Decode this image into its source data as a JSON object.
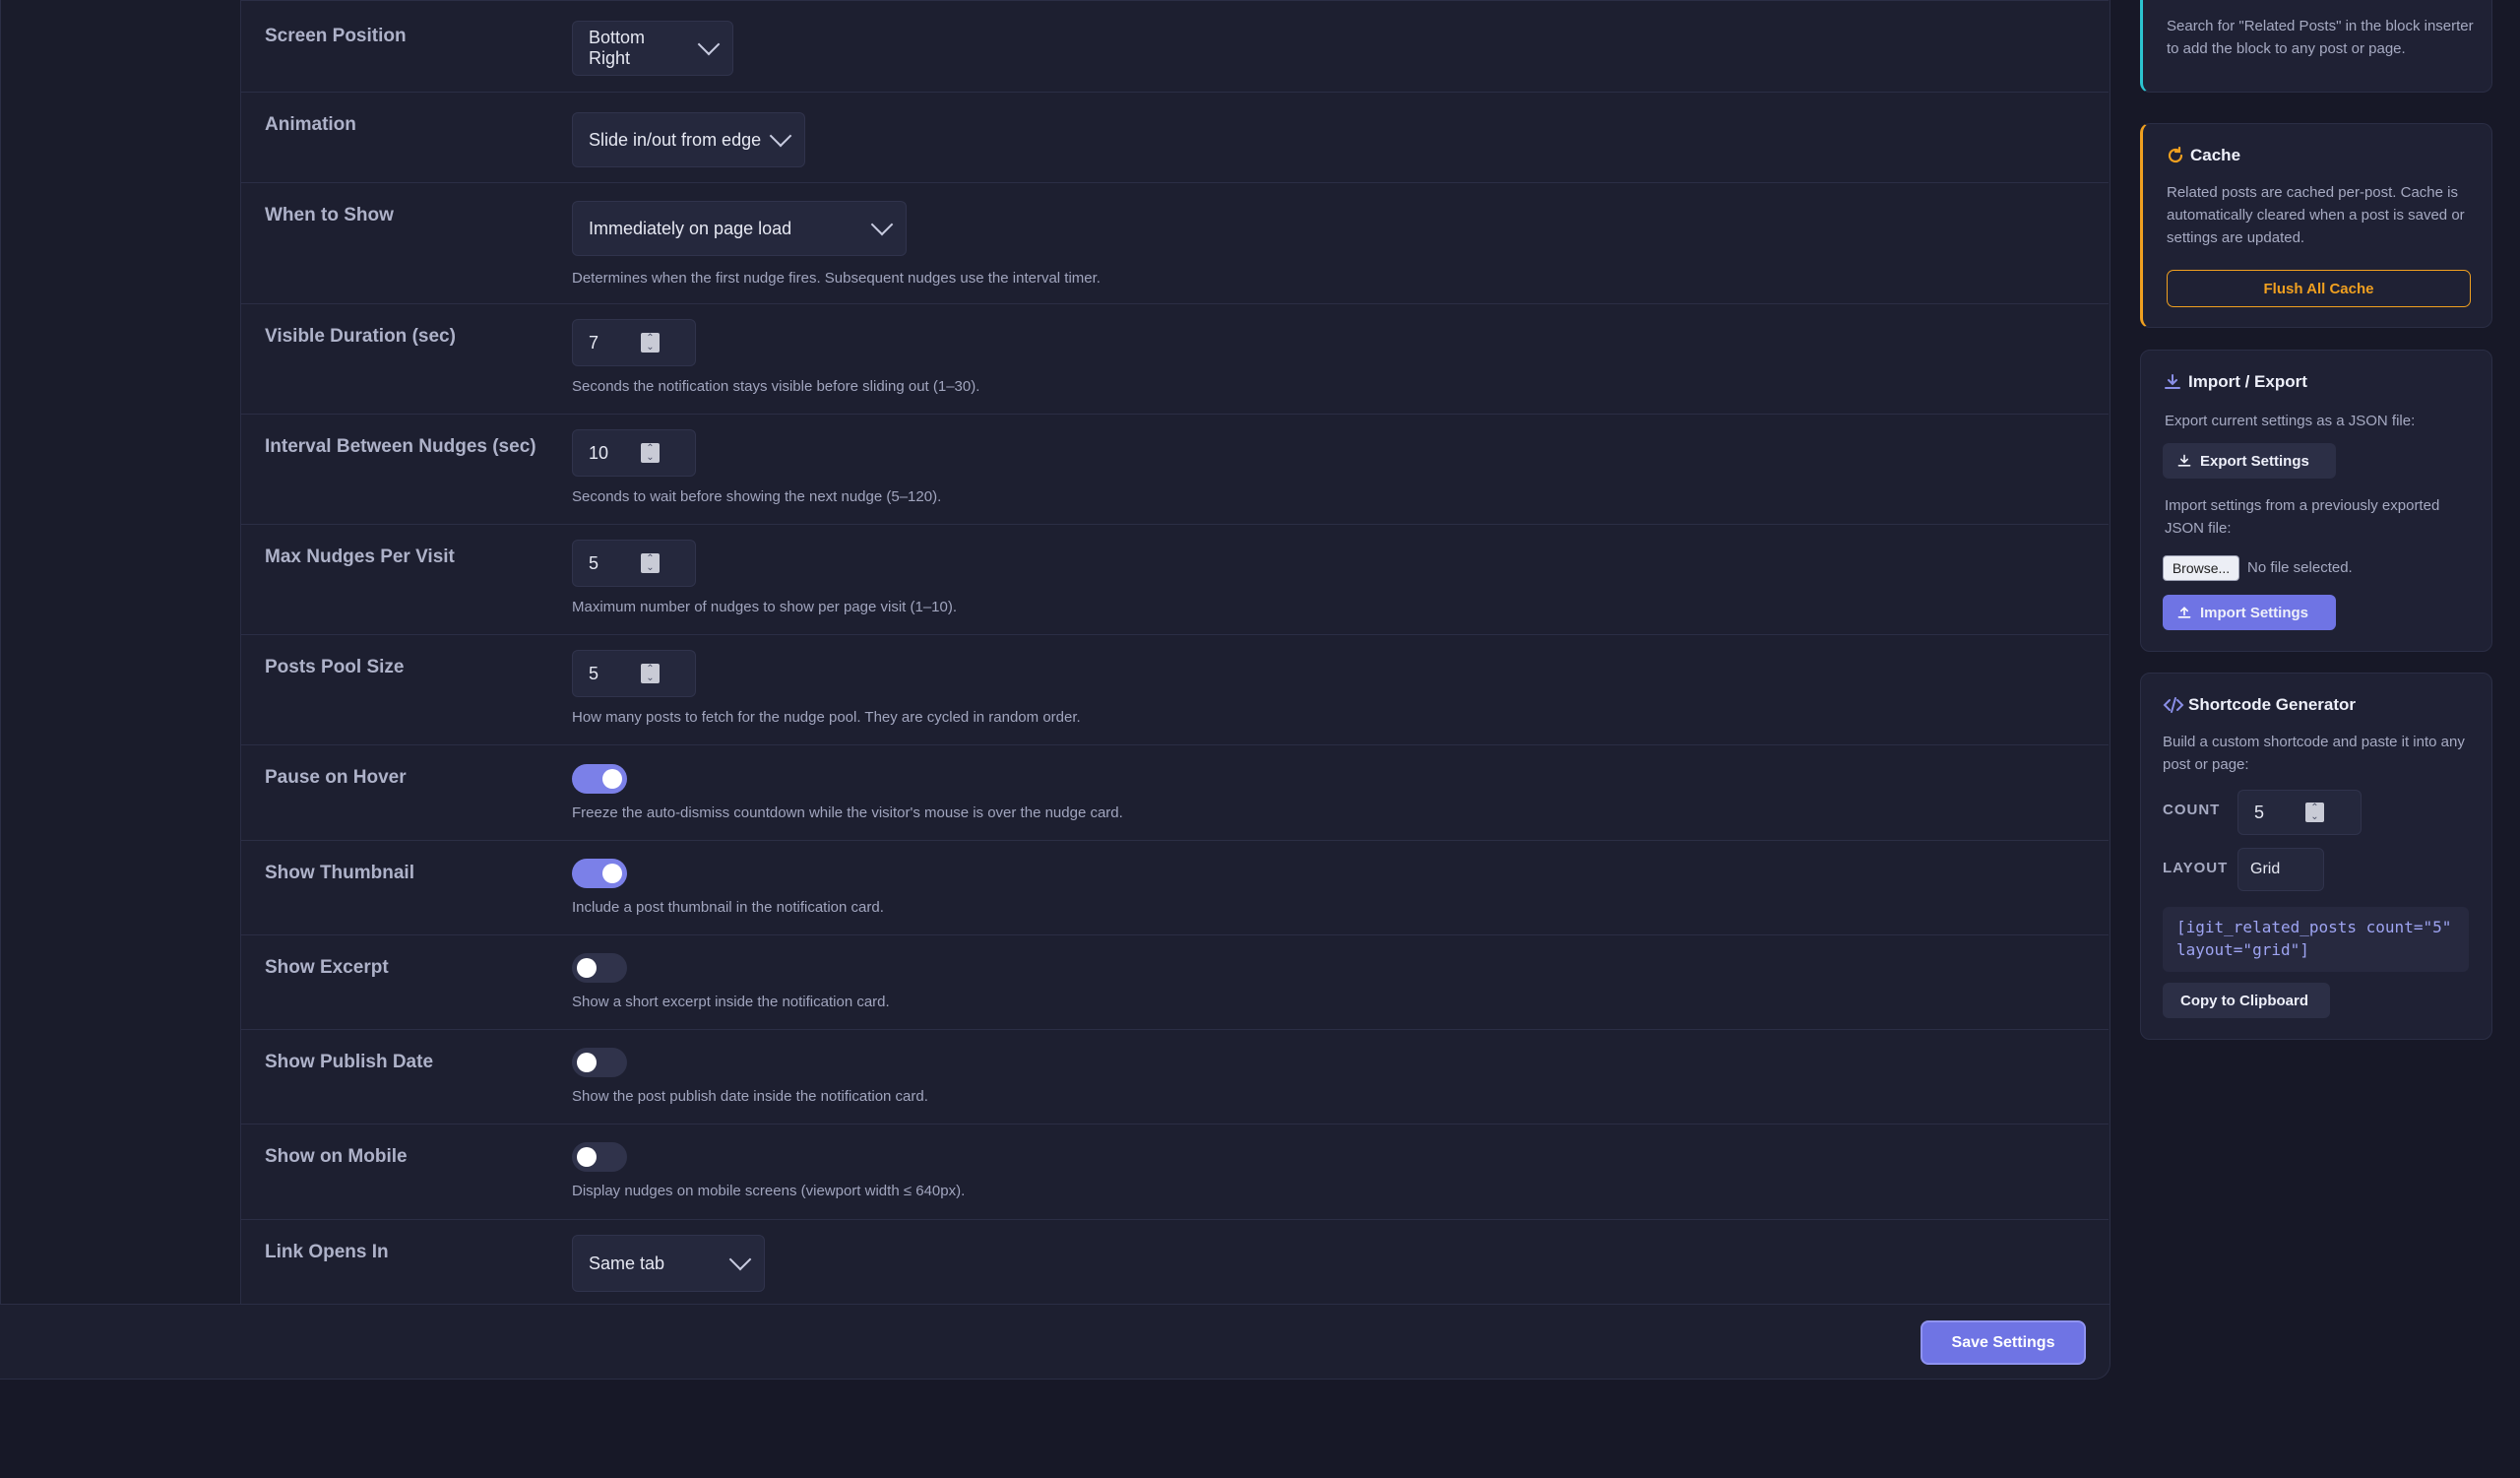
{
  "settings": {
    "screen_position": {
      "label": "Screen Position",
      "value": "Bottom Right"
    },
    "animation": {
      "label": "Animation",
      "value": "Slide in/out from edge"
    },
    "when_to_show": {
      "label": "When to Show",
      "value": "Immediately on page load",
      "desc": "Determines when the first nudge fires. Subsequent nudges use the interval timer."
    },
    "visible_duration": {
      "label": "Visible Duration (sec)",
      "value": "7",
      "desc": "Seconds the notification stays visible before sliding out (1–30)."
    },
    "interval": {
      "label": "Interval Between Nudges (sec)",
      "value": "10",
      "desc": "Seconds to wait before showing the next nudge (5–120)."
    },
    "max_nudges": {
      "label": "Max Nudges Per Visit",
      "value": "5",
      "desc": "Maximum number of nudges to show per page visit (1–10)."
    },
    "pool_size": {
      "label": "Posts Pool Size",
      "value": "5",
      "desc": "How many posts to fetch for the nudge pool. They are cycled in random order."
    },
    "pause_on_hover": {
      "label": "Pause on Hover",
      "on": true,
      "desc": "Freeze the auto-dismiss countdown while the visitor's mouse is over the nudge card."
    },
    "show_thumbnail": {
      "label": "Show Thumbnail",
      "on": true,
      "desc": "Include a post thumbnail in the notification card."
    },
    "show_excerpt": {
      "label": "Show Excerpt",
      "on": false,
      "desc": "Show a short excerpt inside the notification card."
    },
    "show_publish_date": {
      "label": "Show Publish Date",
      "on": false,
      "desc": "Show the post publish date inside the notification card."
    },
    "show_on_mobile": {
      "label": "Show on Mobile",
      "on": false,
      "desc": "Display nudges on mobile screens (viewport width ≤ 640px)."
    },
    "link_opens_in": {
      "label": "Link Opens In",
      "value": "Same tab"
    }
  },
  "footer": {
    "save_label": "Save Settings"
  },
  "sidebar": {
    "block_tip": {
      "text": "Search for \"Related Posts\" in the block inserter to add the block to any post or page."
    },
    "cache": {
      "title": "Cache",
      "text": "Related posts are cached per-post. Cache is automatically cleared when a post is saved or settings are updated.",
      "button": "Flush All Cache"
    },
    "import_export": {
      "title": "Import / Export",
      "export_text": "Export current settings as a JSON file:",
      "export_button": "Export Settings",
      "import_text": "Import settings from a previously exported JSON file:",
      "browse_button": "Browse...",
      "file_status": "No file selected.",
      "import_button": "Import Settings"
    },
    "shortcode": {
      "title": "Shortcode Generator",
      "text": "Build a custom shortcode and paste it into any post or page:",
      "count_label": "COUNT",
      "count_value": "5",
      "layout_label": "LAYOUT",
      "layout_value": "Grid",
      "code": "[igit_related_posts count=\"5\" layout=\"grid\"]",
      "copy_button": "Copy to Clipboard"
    }
  },
  "colors": {
    "accent": "#7b80e8",
    "cache_accent": "#f0a020",
    "tip_accent": "#2cc4d0"
  }
}
